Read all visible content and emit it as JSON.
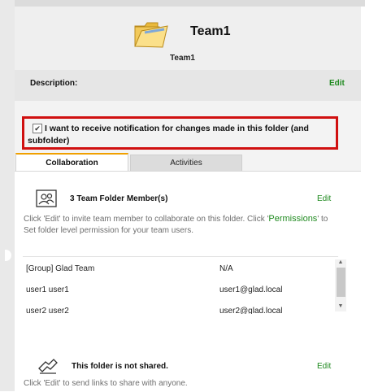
{
  "header": {
    "title": "Team1",
    "subtitle": "Team1",
    "folder_icon": "open-folder-icon"
  },
  "description": {
    "label": "Description:",
    "edit_label": "Edit"
  },
  "notification": {
    "checked": true,
    "label": "I want to receive notification for changes made in this folder (and subfolder)"
  },
  "tabs": [
    {
      "label": "Collaboration",
      "active": true
    },
    {
      "label": "Activities",
      "active": false
    }
  ],
  "members": {
    "title": "3 Team Folder Member(s)",
    "edit_label": "Edit",
    "help_before": "Click 'Edit' to invite team member to collaborate on this folder. Click '",
    "help_link": "Permissions",
    "help_after": "' to Set folder level permission for your team users.",
    "rows": [
      {
        "name": "[Group] Glad Team",
        "email": "N/A"
      },
      {
        "name": "user1 user1",
        "email": "user1@glad.local"
      },
      {
        "name": "user2 user2",
        "email": "user2@glad.local"
      }
    ]
  },
  "sharing": {
    "title": "This folder is not shared.",
    "edit_label": "Edit",
    "help": "Click 'Edit' to send links to share with anyone."
  },
  "colors": {
    "accent_green": "#1f8a1f",
    "highlight_red": "#d01010",
    "tab_active_border": "#f0a000"
  }
}
